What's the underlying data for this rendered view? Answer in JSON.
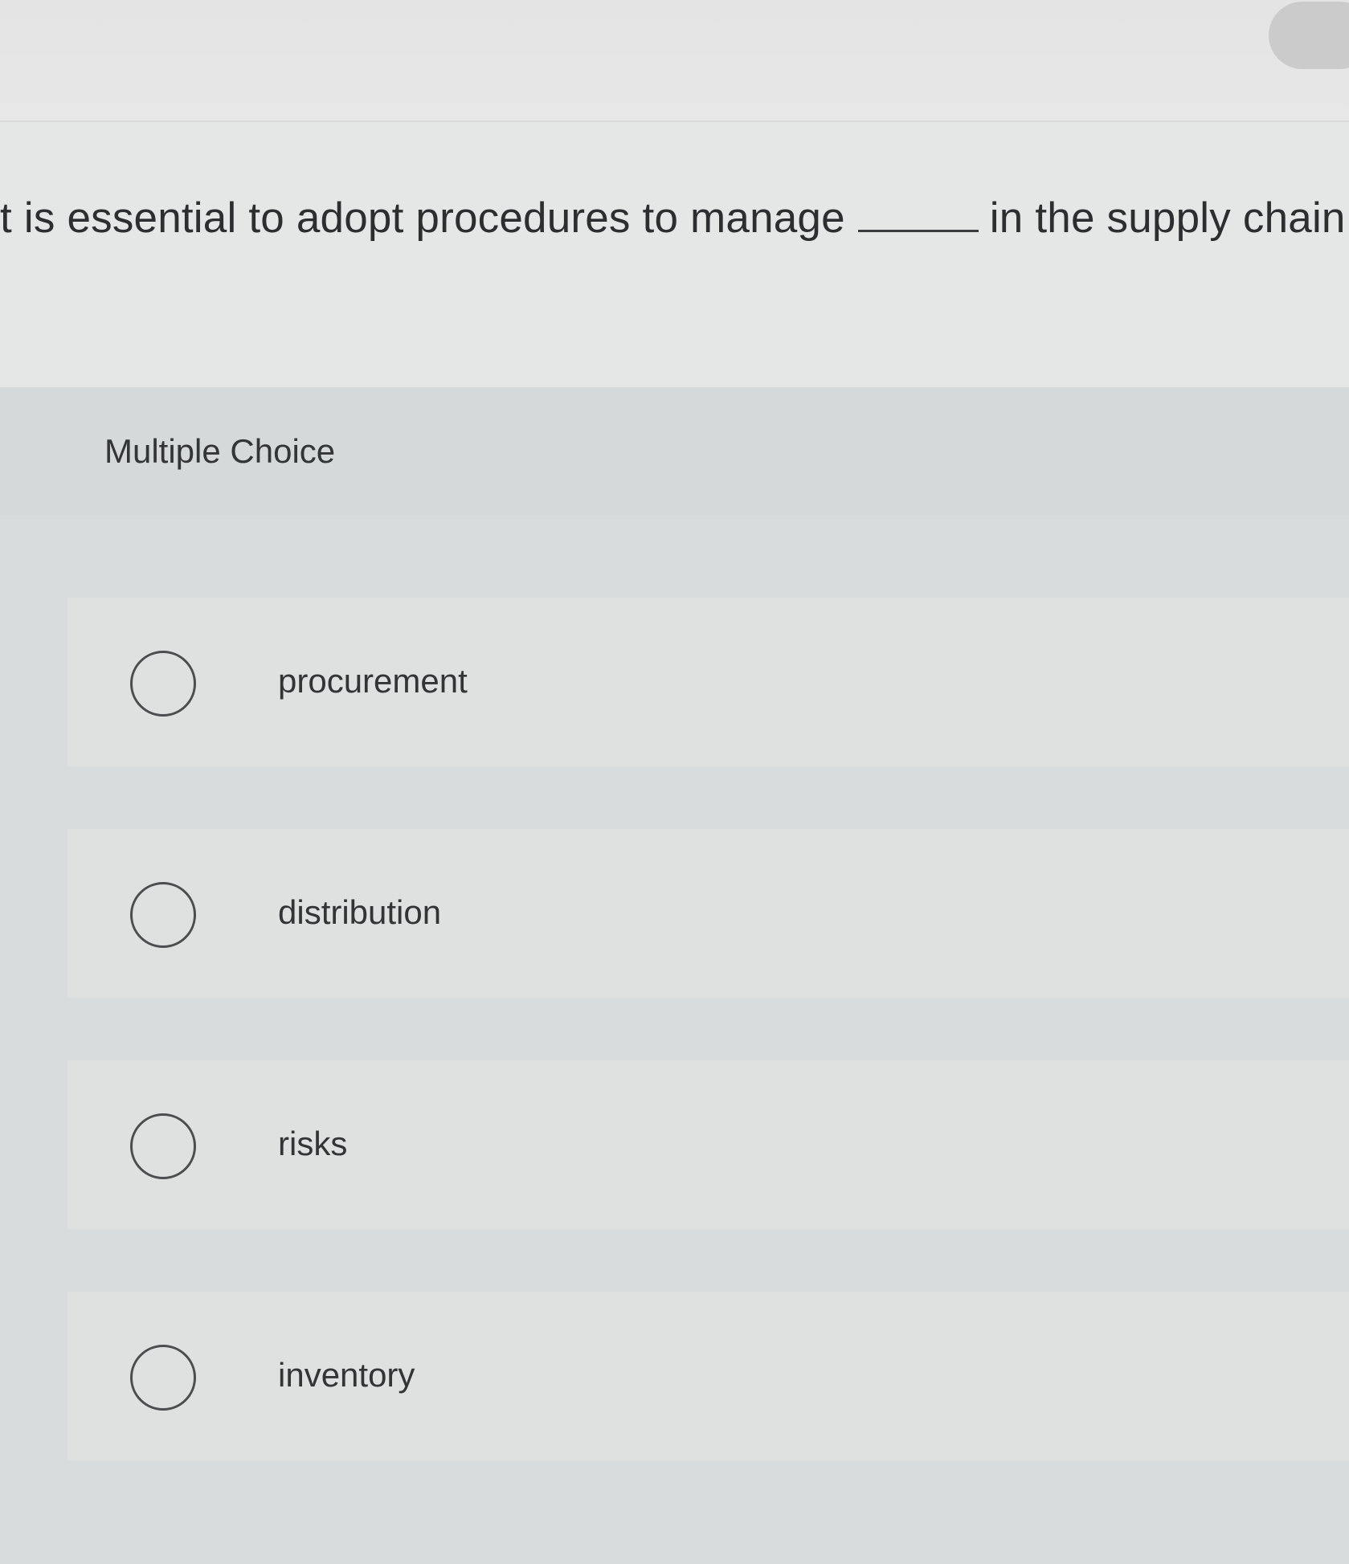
{
  "question": {
    "text_before": "t is essential to adopt procedures to manage",
    "text_after": "in the supply chain."
  },
  "multiple_choice": {
    "header": "Multiple Choice",
    "options": [
      {
        "label": "procurement"
      },
      {
        "label": "distribution"
      },
      {
        "label": "risks"
      },
      {
        "label": "inventory"
      }
    ]
  },
  "colors": {
    "background": "#e3e4e4",
    "panel": "#d9dcdc",
    "text": "#2f3132",
    "radio_border": "#4b4d4f"
  }
}
